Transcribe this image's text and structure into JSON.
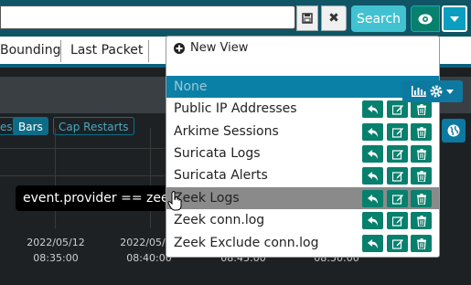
{
  "search": {
    "query": "",
    "button_label": "Search"
  },
  "columns": [
    "Bounding",
    "Last Packet"
  ],
  "visualization": {
    "buttons": [
      "es",
      "Bars",
      "Cap Restarts"
    ]
  },
  "chart": {
    "ticks": [
      {
        "date": "2022/05/12",
        "time": "08:35:00"
      },
      {
        "date": "2022/05/12",
        "time": "08:40:00"
      },
      {
        "date": "",
        "time": "08:45:00"
      },
      {
        "date": "",
        "time": "08:50:00"
      }
    ]
  },
  "tooltip": "event.provider == zeek",
  "views_menu": {
    "new_view_label": "New View",
    "items": [
      {
        "label": "None"
      },
      {
        "label": "Public IP Addresses"
      },
      {
        "label": "Arkime Sessions"
      },
      {
        "label": "Suricata Logs"
      },
      {
        "label": "Suricata Alerts"
      },
      {
        "label": "Zeek Logs"
      },
      {
        "label": "Zeek conn.log"
      },
      {
        "label": "Zeek Exclude conn.log"
      }
    ]
  },
  "colors": {
    "accent": "#42c2d0",
    "action_green": "#07806d",
    "selected_blue": "#0b80a6",
    "hover_gray": "#8a8a8a"
  },
  "icons": [
    "save-icon",
    "close-icon",
    "eye-icon",
    "caret-down-icon",
    "plus-circle-icon",
    "bar-chart-icon",
    "gear-icon",
    "globe-icon",
    "reply-icon",
    "edit-icon",
    "trash-icon",
    "hand-cursor-icon"
  ]
}
